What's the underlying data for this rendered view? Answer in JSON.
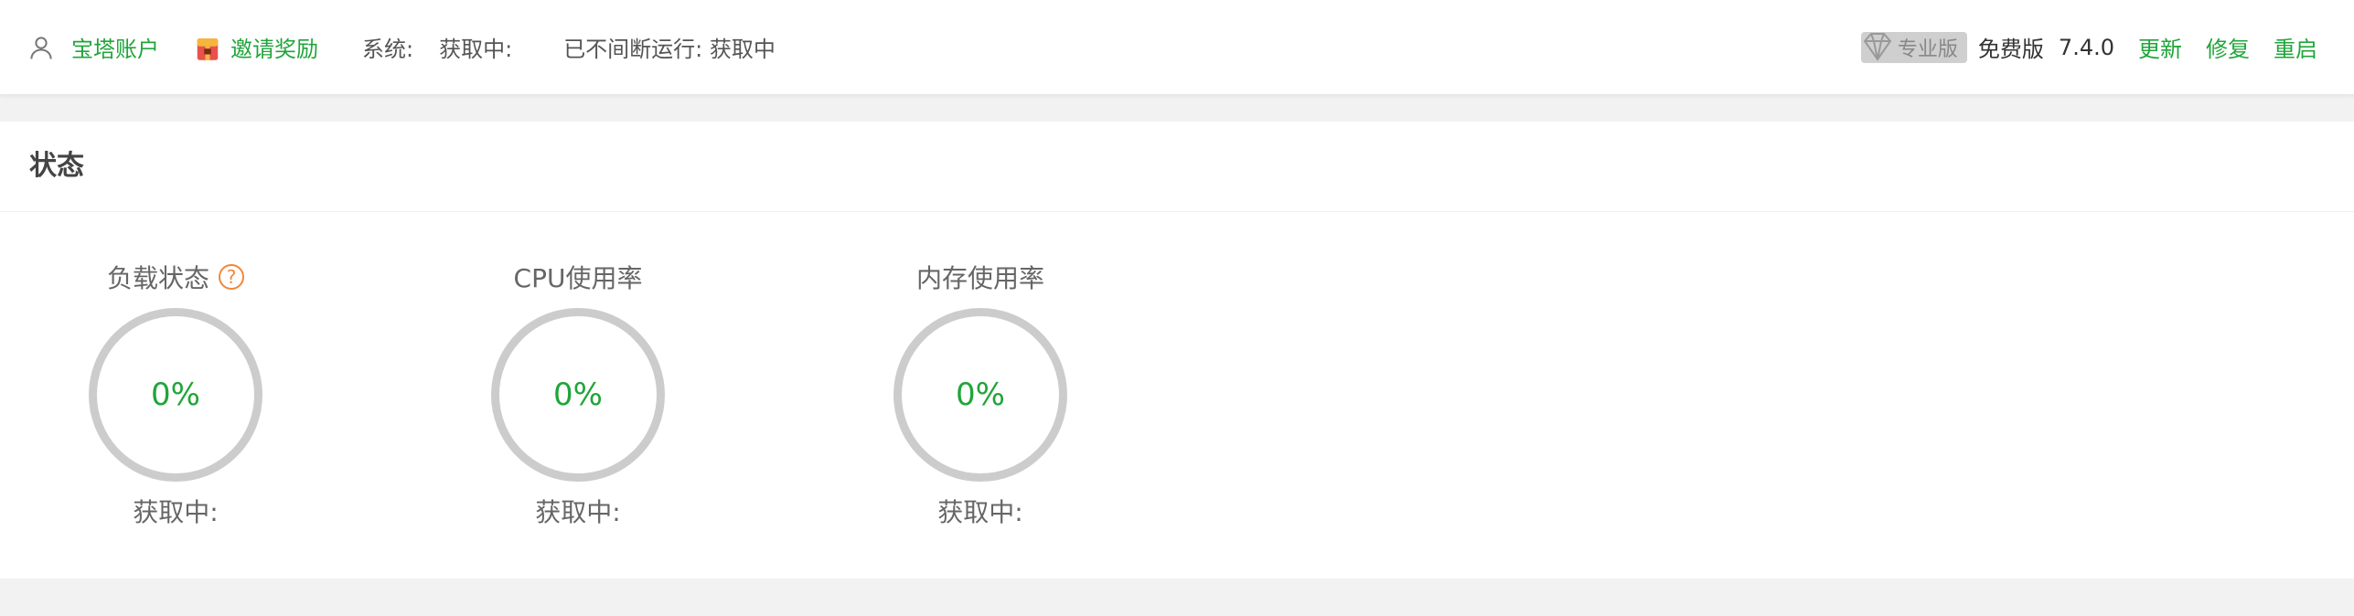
{
  "header": {
    "account_label": "宝塔账户",
    "invite_label": "邀请奖励",
    "system_label": "系统:",
    "system_value": "获取中:",
    "uptime_label": "已不间断运行: 获取中",
    "pro_label": "专业版",
    "free_label": "免费版",
    "version": "7.4.0",
    "update_label": "更新",
    "repair_label": "修复",
    "restart_label": "重启"
  },
  "status_card": {
    "title": "状态",
    "gauges": [
      {
        "label": "负载状态",
        "value": "0%",
        "status": "获取中:",
        "help_icon": "?"
      },
      {
        "label": "CPU使用率",
        "value": "0%",
        "status": "获取中:"
      },
      {
        "label": "内存使用率",
        "value": "0%",
        "status": "获取中:"
      }
    ]
  },
  "colors": {
    "accent": "#20a53a",
    "ring": "#cccccc",
    "help": "#f0883a"
  }
}
